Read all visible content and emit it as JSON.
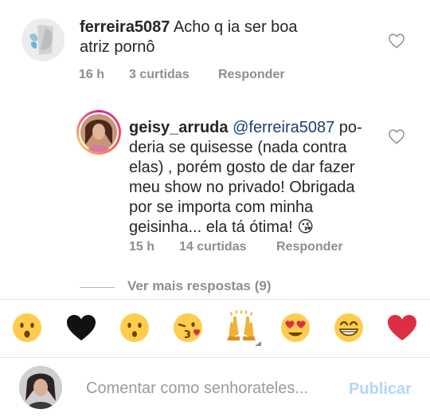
{
  "comment": {
    "username": "ferreira5087",
    "text_line1": "Acho q ia ser boa",
    "text_line2": "atriz pornô",
    "time": "16 h",
    "likes": "3 curtidas",
    "reply": "Responder"
  },
  "reply": {
    "username": "geisy_arruda",
    "mention": "@ferreira5087",
    "lines": [
      "po-",
      "deria se quisesse (nada contra",
      "elas) , porém gosto de dar fazer",
      "meu show no privado! Obrigada",
      "por se importa com minha",
      "geisinha... ela tá ótima!"
    ],
    "emoji": "😘",
    "time": "15 h",
    "likes": "14 curtidas",
    "reply": "Responder"
  },
  "more_replies": "Ver mais respostas (9)",
  "emoji_bar": [
    "😮",
    "🖤",
    "😮",
    "😘",
    "🙌",
    "😍",
    "😁",
    "❤️"
  ],
  "composer": {
    "placeholder": "Comentar como senhorateles...",
    "publish": "Publicar"
  },
  "colors": {
    "publish": "#b3d7f5",
    "meta": "#8e8e8e",
    "story_ring": "#d6249f"
  }
}
